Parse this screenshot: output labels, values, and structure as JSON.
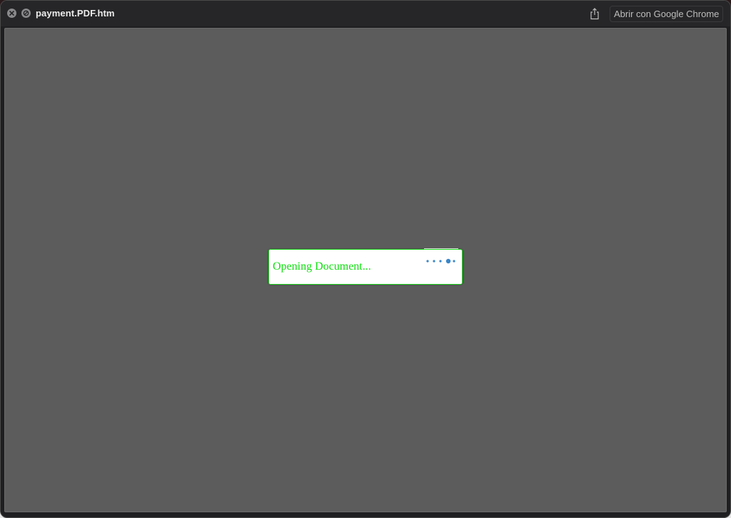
{
  "window": {
    "title": "payment.PDF.htm",
    "open_with_label": "Abrir con Google Chrome"
  },
  "titlebar": {
    "close_icon": "close-icon",
    "stop_icon": "stop-icon",
    "share_icon": "share-icon"
  },
  "dialog": {
    "message": "Opening Document...",
    "spinner_icon": "loading-dots-icon"
  },
  "colors": {
    "content_background": "#5c5c5c",
    "dialog_border": "#1ad61a",
    "dialog_text": "#10e010",
    "spinner_dots": "#3a86c8"
  }
}
